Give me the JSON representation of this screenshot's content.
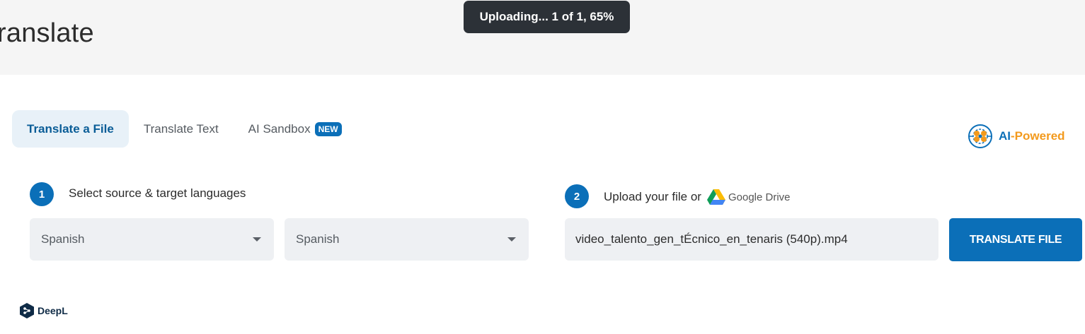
{
  "header": {
    "title": "ranslate"
  },
  "toast": {
    "text": "Uploading... 1 of 1, 65%",
    "progress_percent": 65
  },
  "tabs": [
    {
      "label": "Translate a File",
      "active": true
    },
    {
      "label": "Translate Text",
      "active": false
    },
    {
      "label": "AI Sandbox",
      "active": false,
      "badge": "NEW"
    }
  ],
  "ai_powered": {
    "ai": "AI",
    "dash": "-",
    "powered": "Powered",
    "icon": "brain-network-icon"
  },
  "step1": {
    "number": "1",
    "label": "Select source & target languages"
  },
  "step2": {
    "number": "2",
    "label": "Upload your file or",
    "drive_brand": "Google",
    "drive_label": "Drive",
    "icon": "google-drive-icon"
  },
  "source_language": {
    "value": "Spanish"
  },
  "target_language": {
    "value": "Spanish"
  },
  "file": {
    "name": "video_talento_gen_tÉcnico_en_tenaris (540p).mp4"
  },
  "translate_button": {
    "label": "TRANSLATE FILE"
  },
  "footer": {
    "brand": "DeepL",
    "icon": "deepl-logo-icon"
  },
  "colors": {
    "accent": "#0b6fb8",
    "orange": "#f39a1d",
    "toast_bg": "#2c3137",
    "field_bg": "#eef0f3",
    "tab_active_bg": "#e8f1f8"
  }
}
